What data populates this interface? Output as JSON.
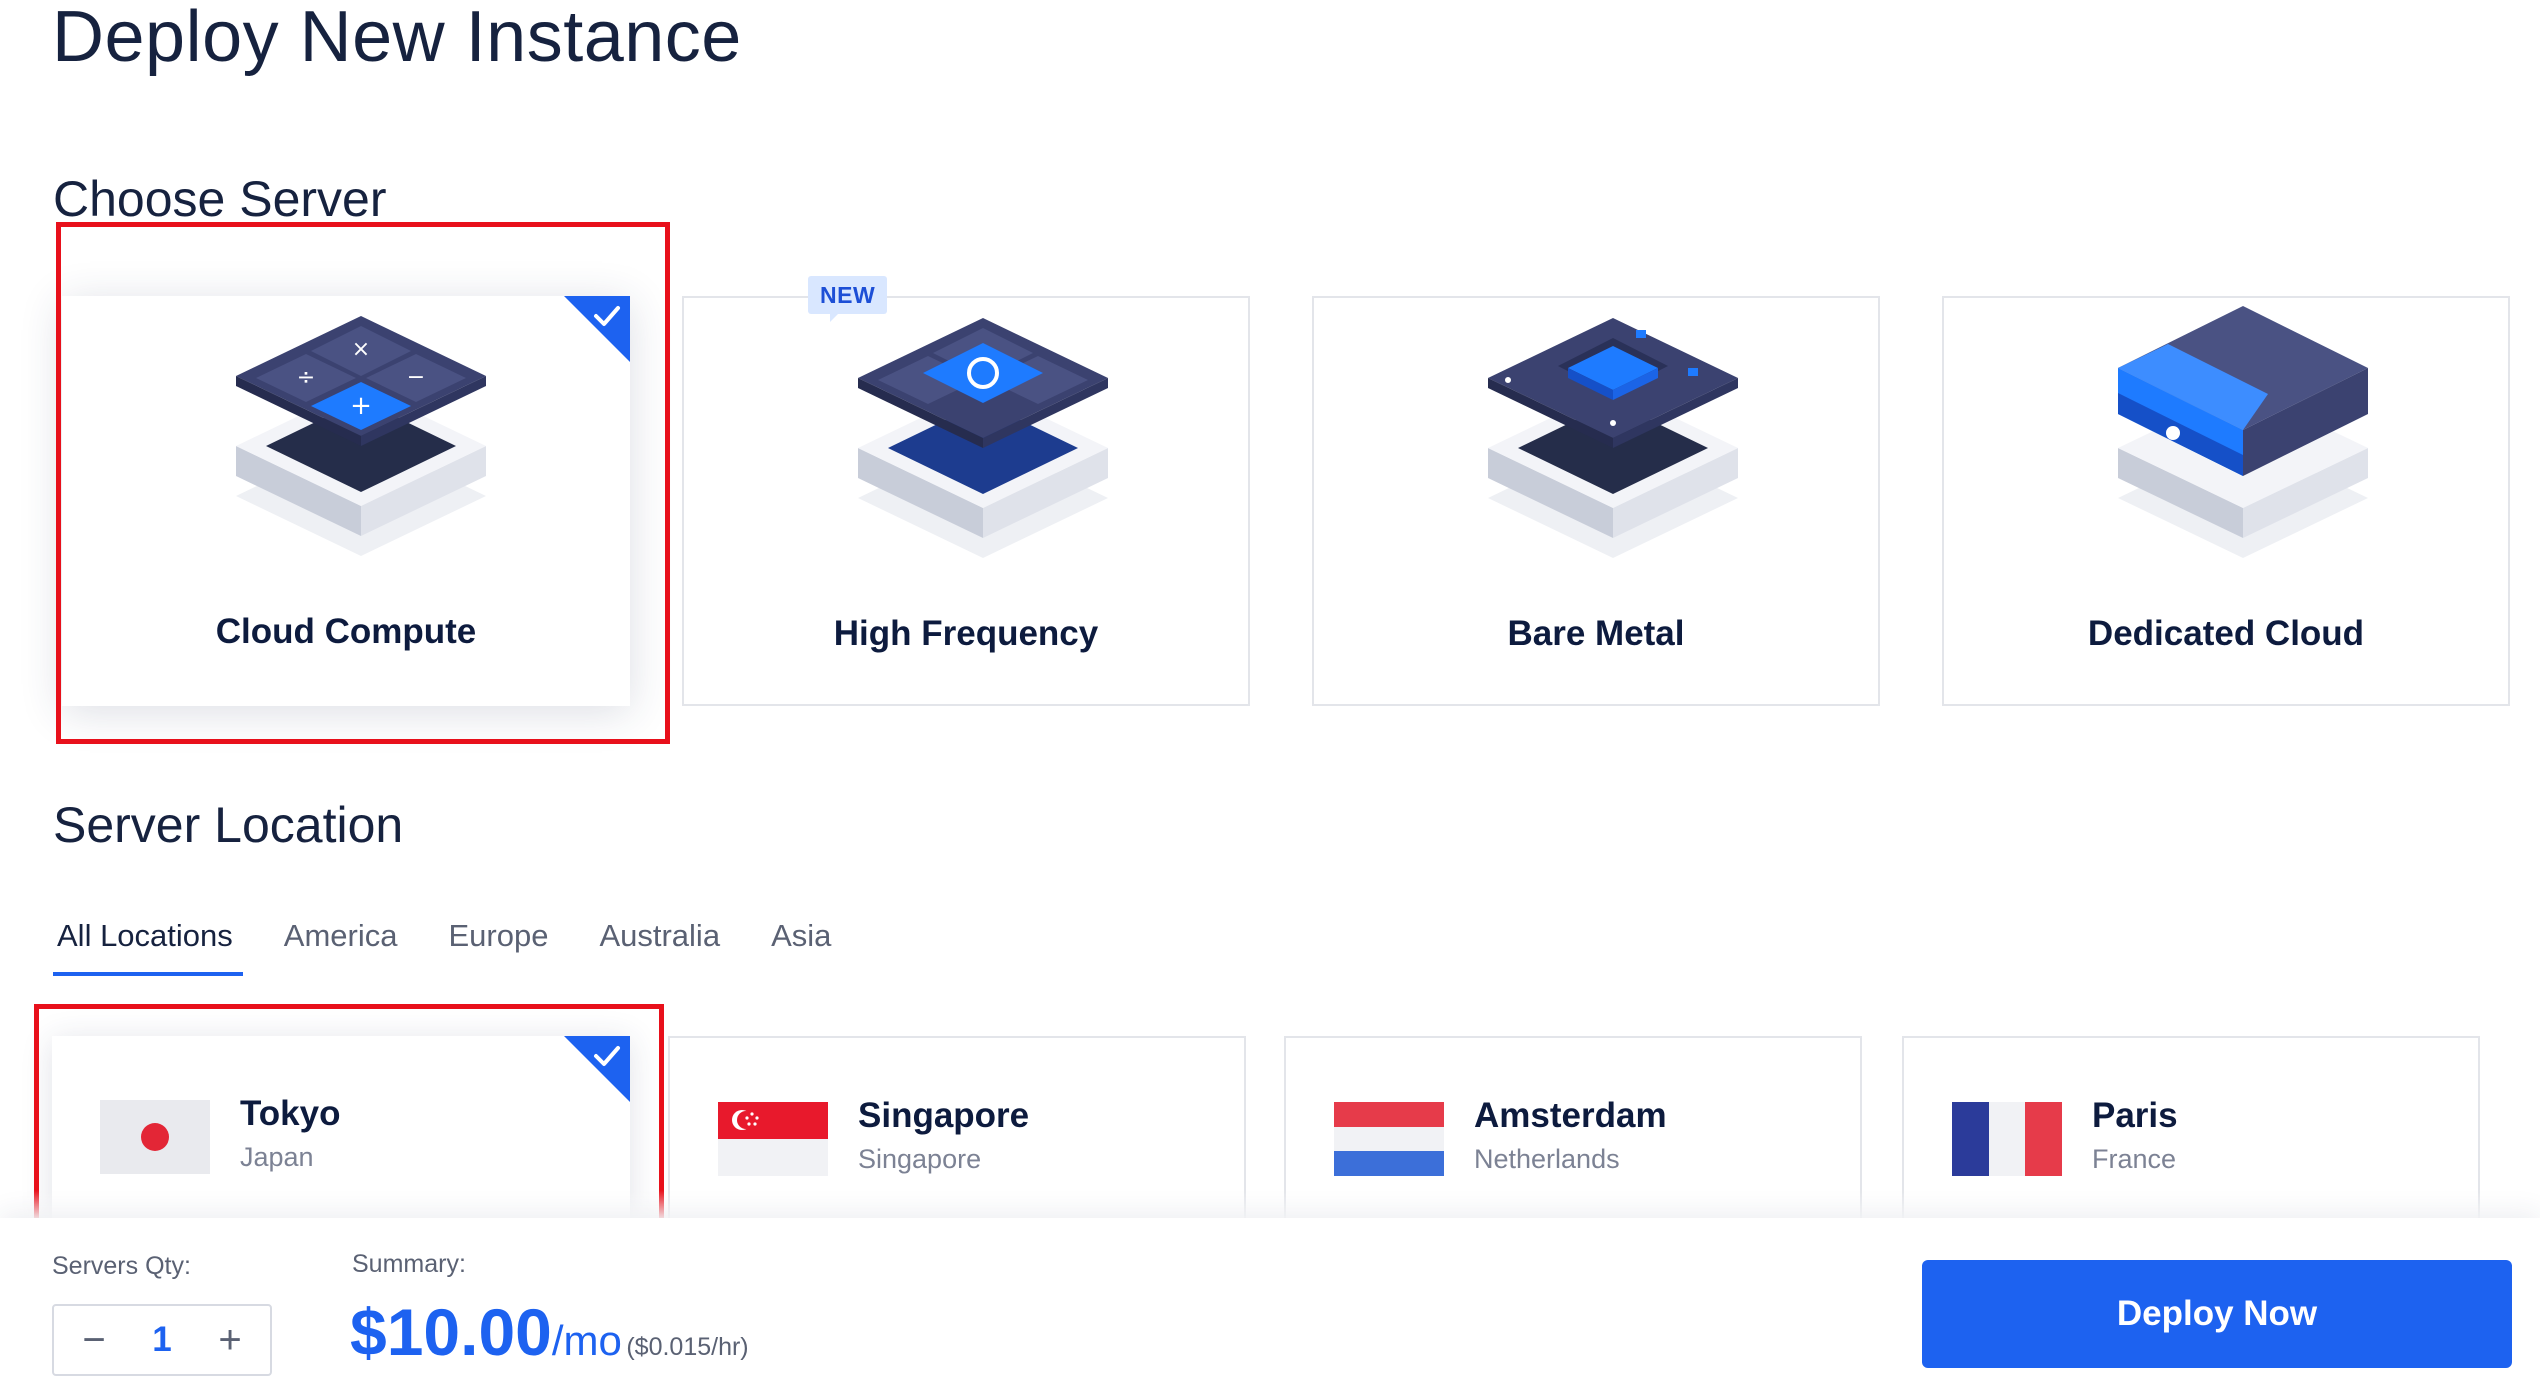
{
  "page": {
    "title": "Deploy New Instance"
  },
  "choose_server": {
    "title": "Choose Server",
    "selected": "Cloud Compute",
    "badge_new": "NEW",
    "options": [
      {
        "label": "Cloud Compute",
        "icon": "cloud-compute-server-icon"
      },
      {
        "label": "High Frequency",
        "icon": "high-frequency-server-icon"
      },
      {
        "label": "Bare Metal",
        "icon": "bare-metal-server-icon"
      },
      {
        "label": "Dedicated Cloud",
        "icon": "dedicated-cloud-server-icon"
      }
    ]
  },
  "server_location": {
    "title": "Server Location",
    "tabs": [
      "All Locations",
      "America",
      "Europe",
      "Australia",
      "Asia"
    ],
    "active_tab": "All Locations",
    "selected": "Tokyo",
    "locations": [
      {
        "city": "Tokyo",
        "country": "Japan",
        "flag": "japan-flag-icon"
      },
      {
        "city": "Singapore",
        "country": "Singapore",
        "flag": "singapore-flag-icon"
      },
      {
        "city": "Amsterdam",
        "country": "Netherlands",
        "flag": "netherlands-flag-icon"
      },
      {
        "city": "Paris",
        "country": "France",
        "flag": "france-flag-icon"
      }
    ]
  },
  "footer": {
    "qty_label": "Servers Qty:",
    "qty_value": "1",
    "minus": "−",
    "plus": "+",
    "summary_label": "Summary:",
    "price": "$10.00",
    "price_unit": "/mo",
    "price_hourly": "($0.015/hr)",
    "deploy_label": "Deploy Now"
  },
  "colors": {
    "accent": "#1d62f0",
    "highlight": "#e8101b",
    "text": "#16223f"
  }
}
